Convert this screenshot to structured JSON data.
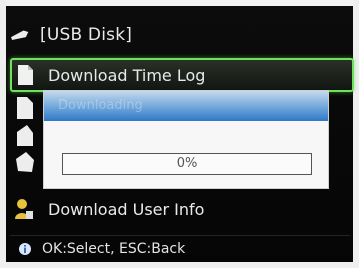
{
  "header": {
    "title": "[USB Disk]",
    "icon": "usb-disk-icon"
  },
  "menu": {
    "selected_item": "Download Time Log",
    "items": [
      {
        "label": "Download Time Log",
        "icon": "document-icon",
        "selected": true
      },
      {
        "label": "Download User Info",
        "icon": "user-icon",
        "selected": false
      }
    ]
  },
  "dialog": {
    "header_text": "Downloading",
    "progress_text": "0%",
    "progress_value": 0
  },
  "footer": {
    "hint": "OK:Select, ESC:Back",
    "icon": "info-icon"
  },
  "colors": {
    "selection_border": "#6fe25c",
    "dialog_header": "#2f78c7",
    "background": "#0a0a0a",
    "text": "#e9e9e9"
  }
}
